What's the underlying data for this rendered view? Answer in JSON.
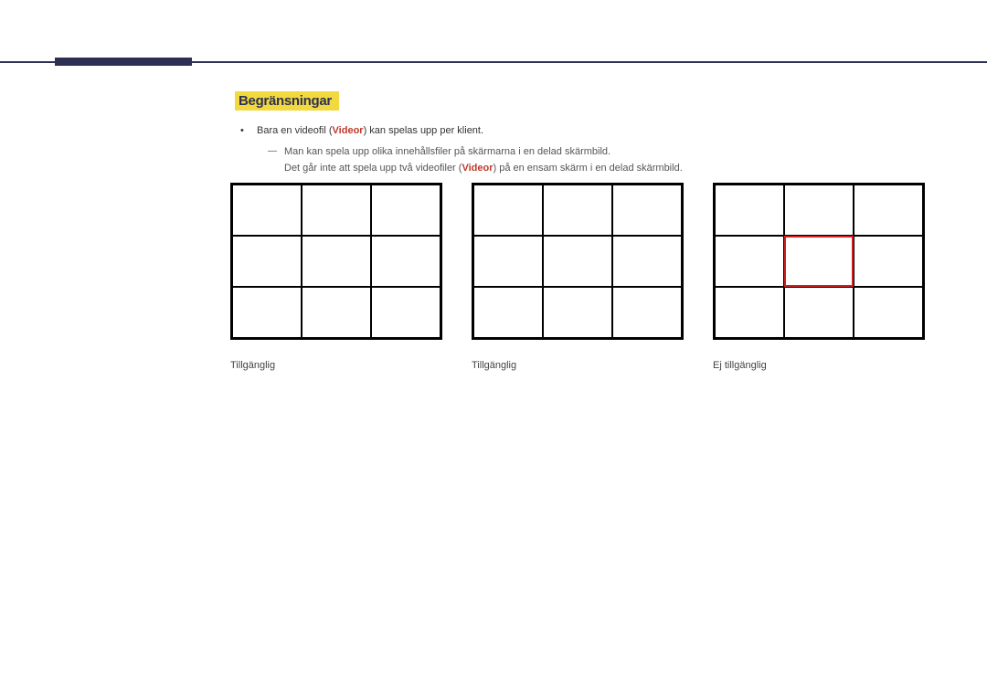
{
  "section": {
    "title": "Begränsningar"
  },
  "bullet": {
    "text_before": "Bara en videofil (",
    "videor": "Videor",
    "text_after": ") kan spelas upp per klient."
  },
  "subline1": "Man kan spela upp olika innehållsfiler på skärmarna i en delad skärmbild.",
  "subline2": {
    "before": "Det går inte att spela upp två videofiler (",
    "videor": "Videor",
    "after": ") på en ensam skärm i en delad skärmbild."
  },
  "captions": {
    "g1": "Tillgänglig",
    "g2": "Tillgänglig",
    "g3": "Ej tillgänglig"
  }
}
